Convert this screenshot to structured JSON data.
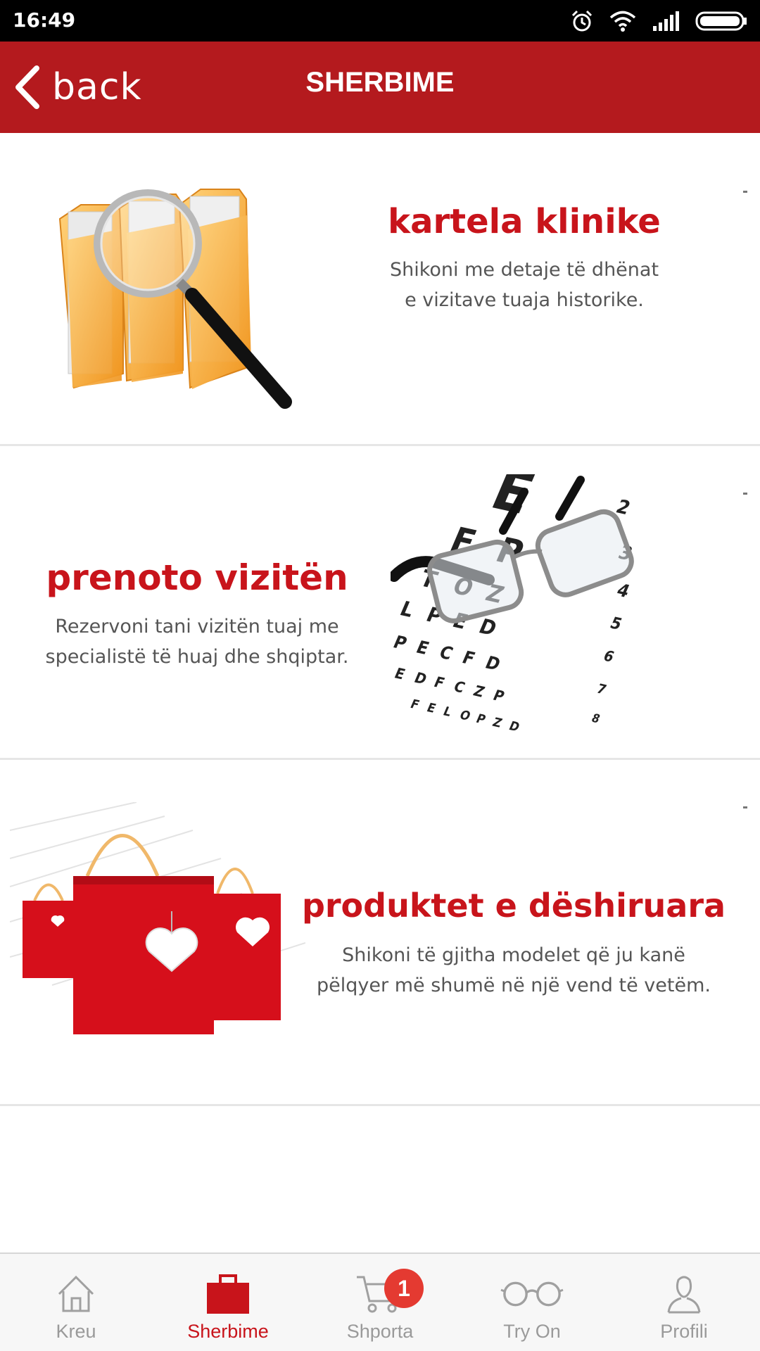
{
  "status_bar": {
    "time": "16:49"
  },
  "app_bar": {
    "back_label": "back",
    "title": "SHERBIME"
  },
  "cards": [
    {
      "title": "kartela klinike",
      "desc_line1": "Shikoni me detaje të dhënat",
      "desc_line2": "e  vizitave tuaja historike."
    },
    {
      "title": "prenoto vizitën",
      "desc_line1": "Rezervoni tani vizitën tuaj me",
      "desc_line2": "specialistë të huaj dhe shqiptar.",
      "chart_letters": [
        "E",
        "F",
        "P",
        "T",
        "O",
        "Z",
        "L",
        "P",
        "E",
        "D",
        "P",
        "E",
        "C",
        "F",
        "D",
        "E",
        "D",
        "F",
        "C",
        "Z",
        "P",
        "F",
        "E",
        "L",
        "O",
        "P",
        "Z",
        "D",
        "2",
        "3",
        "4",
        "5",
        "6",
        "7",
        "8"
      ]
    },
    {
      "title": "produktet e dëshiruara",
      "desc_line1": "Shikoni të gjitha modelet që ju kanë",
      "desc_line2": "pëlqyer më shumë në një vend të vetëm."
    }
  ],
  "bottom_nav": {
    "items": [
      {
        "label": "Kreu"
      },
      {
        "label": "Sherbime"
      },
      {
        "label": "Shporta"
      },
      {
        "label": "Try On"
      },
      {
        "label": "Profili"
      }
    ],
    "cart_badge": "1"
  },
  "colors": {
    "accent": "#b41a1e",
    "heading_red": "#c8141b",
    "inactive": "#9a9a9a",
    "badge": "#e43a31"
  }
}
